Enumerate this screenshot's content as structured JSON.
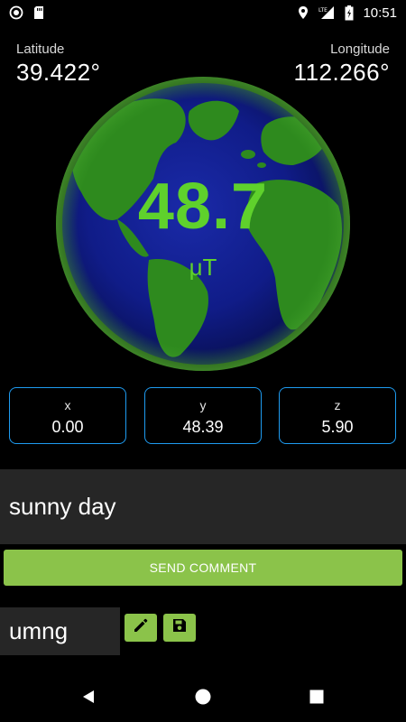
{
  "status_bar": {
    "time": "10:51",
    "network": "LTE",
    "icons": [
      "circle-notification-icon",
      "sd-card-icon",
      "location-icon",
      "lte-signal-icon",
      "battery-charging-icon"
    ]
  },
  "coordinates": {
    "latitude_label": "Latitude",
    "latitude_value": "39.422°",
    "longitude_label": "Longitude",
    "longitude_value": "112.266°"
  },
  "reading": {
    "value": "48.7",
    "unit": "μT",
    "color": "#5fd12c"
  },
  "axes": [
    {
      "label": "x",
      "value": "0.00"
    },
    {
      "label": "y",
      "value": "48.39"
    },
    {
      "label": "z",
      "value": "5.90"
    }
  ],
  "comment": {
    "value": "sunny day",
    "button_label": "SEND COMMENT"
  },
  "name": {
    "value": "umng",
    "edit_icon": "pencil-icon",
    "save_icon": "floppy-disk-icon"
  },
  "colors": {
    "accent": "#8bc34a",
    "box_border": "#1e9bf0",
    "field_background": "#262626"
  },
  "nav": {
    "icons": [
      "back-icon",
      "home-icon",
      "recents-icon"
    ]
  }
}
